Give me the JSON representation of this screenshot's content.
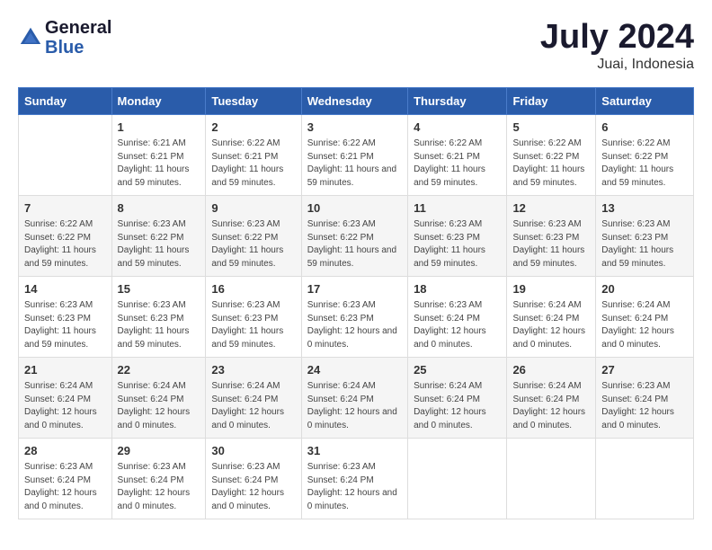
{
  "header": {
    "logo_line1": "General",
    "logo_line2": "Blue",
    "main_title": "July 2024",
    "subtitle": "Juai, Indonesia"
  },
  "calendar": {
    "days_of_week": [
      "Sunday",
      "Monday",
      "Tuesday",
      "Wednesday",
      "Thursday",
      "Friday",
      "Saturday"
    ],
    "weeks": [
      [
        {
          "num": "",
          "sunrise": "",
          "sunset": "",
          "daylight": ""
        },
        {
          "num": "1",
          "sunrise": "Sunrise: 6:21 AM",
          "sunset": "Sunset: 6:21 PM",
          "daylight": "Daylight: 11 hours and 59 minutes."
        },
        {
          "num": "2",
          "sunrise": "Sunrise: 6:22 AM",
          "sunset": "Sunset: 6:21 PM",
          "daylight": "Daylight: 11 hours and 59 minutes."
        },
        {
          "num": "3",
          "sunrise": "Sunrise: 6:22 AM",
          "sunset": "Sunset: 6:21 PM",
          "daylight": "Daylight: 11 hours and 59 minutes."
        },
        {
          "num": "4",
          "sunrise": "Sunrise: 6:22 AM",
          "sunset": "Sunset: 6:21 PM",
          "daylight": "Daylight: 11 hours and 59 minutes."
        },
        {
          "num": "5",
          "sunrise": "Sunrise: 6:22 AM",
          "sunset": "Sunset: 6:22 PM",
          "daylight": "Daylight: 11 hours and 59 minutes."
        },
        {
          "num": "6",
          "sunrise": "Sunrise: 6:22 AM",
          "sunset": "Sunset: 6:22 PM",
          "daylight": "Daylight: 11 hours and 59 minutes."
        }
      ],
      [
        {
          "num": "7",
          "sunrise": "Sunrise: 6:22 AM",
          "sunset": "Sunset: 6:22 PM",
          "daylight": "Daylight: 11 hours and 59 minutes."
        },
        {
          "num": "8",
          "sunrise": "Sunrise: 6:23 AM",
          "sunset": "Sunset: 6:22 PM",
          "daylight": "Daylight: 11 hours and 59 minutes."
        },
        {
          "num": "9",
          "sunrise": "Sunrise: 6:23 AM",
          "sunset": "Sunset: 6:22 PM",
          "daylight": "Daylight: 11 hours and 59 minutes."
        },
        {
          "num": "10",
          "sunrise": "Sunrise: 6:23 AM",
          "sunset": "Sunset: 6:22 PM",
          "daylight": "Daylight: 11 hours and 59 minutes."
        },
        {
          "num": "11",
          "sunrise": "Sunrise: 6:23 AM",
          "sunset": "Sunset: 6:23 PM",
          "daylight": "Daylight: 11 hours and 59 minutes."
        },
        {
          "num": "12",
          "sunrise": "Sunrise: 6:23 AM",
          "sunset": "Sunset: 6:23 PM",
          "daylight": "Daylight: 11 hours and 59 minutes."
        },
        {
          "num": "13",
          "sunrise": "Sunrise: 6:23 AM",
          "sunset": "Sunset: 6:23 PM",
          "daylight": "Daylight: 11 hours and 59 minutes."
        }
      ],
      [
        {
          "num": "14",
          "sunrise": "Sunrise: 6:23 AM",
          "sunset": "Sunset: 6:23 PM",
          "daylight": "Daylight: 11 hours and 59 minutes."
        },
        {
          "num": "15",
          "sunrise": "Sunrise: 6:23 AM",
          "sunset": "Sunset: 6:23 PM",
          "daylight": "Daylight: 11 hours and 59 minutes."
        },
        {
          "num": "16",
          "sunrise": "Sunrise: 6:23 AM",
          "sunset": "Sunset: 6:23 PM",
          "daylight": "Daylight: 11 hours and 59 minutes."
        },
        {
          "num": "17",
          "sunrise": "Sunrise: 6:23 AM",
          "sunset": "Sunset: 6:23 PM",
          "daylight": "Daylight: 12 hours and 0 minutes."
        },
        {
          "num": "18",
          "sunrise": "Sunrise: 6:23 AM",
          "sunset": "Sunset: 6:24 PM",
          "daylight": "Daylight: 12 hours and 0 minutes."
        },
        {
          "num": "19",
          "sunrise": "Sunrise: 6:24 AM",
          "sunset": "Sunset: 6:24 PM",
          "daylight": "Daylight: 12 hours and 0 minutes."
        },
        {
          "num": "20",
          "sunrise": "Sunrise: 6:24 AM",
          "sunset": "Sunset: 6:24 PM",
          "daylight": "Daylight: 12 hours and 0 minutes."
        }
      ],
      [
        {
          "num": "21",
          "sunrise": "Sunrise: 6:24 AM",
          "sunset": "Sunset: 6:24 PM",
          "daylight": "Daylight: 12 hours and 0 minutes."
        },
        {
          "num": "22",
          "sunrise": "Sunrise: 6:24 AM",
          "sunset": "Sunset: 6:24 PM",
          "daylight": "Daylight: 12 hours and 0 minutes."
        },
        {
          "num": "23",
          "sunrise": "Sunrise: 6:24 AM",
          "sunset": "Sunset: 6:24 PM",
          "daylight": "Daylight: 12 hours and 0 minutes."
        },
        {
          "num": "24",
          "sunrise": "Sunrise: 6:24 AM",
          "sunset": "Sunset: 6:24 PM",
          "daylight": "Daylight: 12 hours and 0 minutes."
        },
        {
          "num": "25",
          "sunrise": "Sunrise: 6:24 AM",
          "sunset": "Sunset: 6:24 PM",
          "daylight": "Daylight: 12 hours and 0 minutes."
        },
        {
          "num": "26",
          "sunrise": "Sunrise: 6:24 AM",
          "sunset": "Sunset: 6:24 PM",
          "daylight": "Daylight: 12 hours and 0 minutes."
        },
        {
          "num": "27",
          "sunrise": "Sunrise: 6:23 AM",
          "sunset": "Sunset: 6:24 PM",
          "daylight": "Daylight: 12 hours and 0 minutes."
        }
      ],
      [
        {
          "num": "28",
          "sunrise": "Sunrise: 6:23 AM",
          "sunset": "Sunset: 6:24 PM",
          "daylight": "Daylight: 12 hours and 0 minutes."
        },
        {
          "num": "29",
          "sunrise": "Sunrise: 6:23 AM",
          "sunset": "Sunset: 6:24 PM",
          "daylight": "Daylight: 12 hours and 0 minutes."
        },
        {
          "num": "30",
          "sunrise": "Sunrise: 6:23 AM",
          "sunset": "Sunset: 6:24 PM",
          "daylight": "Daylight: 12 hours and 0 minutes."
        },
        {
          "num": "31",
          "sunrise": "Sunrise: 6:23 AM",
          "sunset": "Sunset: 6:24 PM",
          "daylight": "Daylight: 12 hours and 0 minutes."
        },
        {
          "num": "",
          "sunrise": "",
          "sunset": "",
          "daylight": ""
        },
        {
          "num": "",
          "sunrise": "",
          "sunset": "",
          "daylight": ""
        },
        {
          "num": "",
          "sunrise": "",
          "sunset": "",
          "daylight": ""
        }
      ]
    ]
  }
}
